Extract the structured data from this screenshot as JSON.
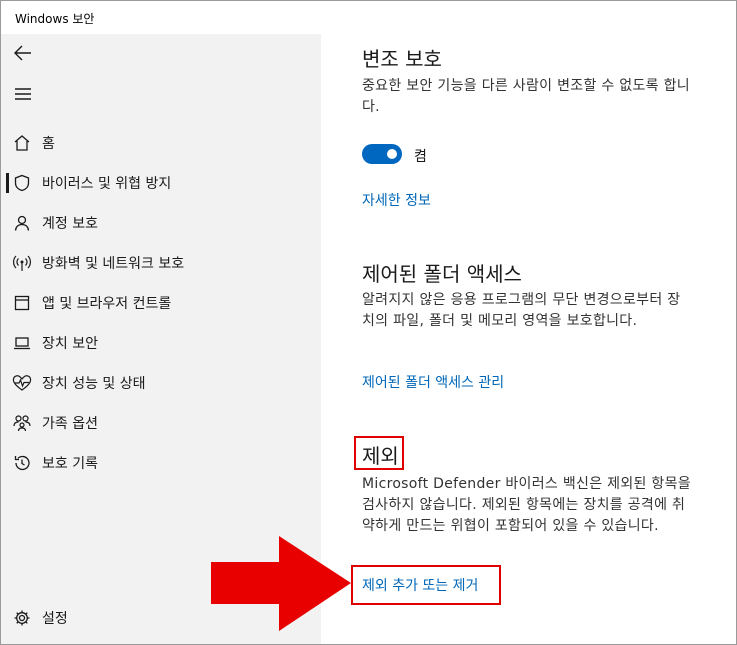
{
  "window": {
    "title": "Windows 보안"
  },
  "sidebar": {
    "back_icon": "back-arrow-icon",
    "menu_icon": "hamburger-menu-icon",
    "items": [
      {
        "label": "홈",
        "icon": "home-icon"
      },
      {
        "label": "바이러스 및 위협 방지",
        "icon": "shield-icon",
        "selected": true
      },
      {
        "label": "계정 보호",
        "icon": "person-icon"
      },
      {
        "label": "방화벽 및 네트워크 보호",
        "icon": "wifi-antenna-icon"
      },
      {
        "label": "앱 및 브라우저 컨트롤",
        "icon": "app-window-icon"
      },
      {
        "label": "장치 보안",
        "icon": "laptop-icon"
      },
      {
        "label": "장치 성능 및 상태",
        "icon": "heart-pulse-icon"
      },
      {
        "label": "가족 옵션",
        "icon": "family-icon"
      },
      {
        "label": "보호 기록",
        "icon": "history-icon"
      }
    ],
    "settings": {
      "label": "설정",
      "icon": "gear-icon"
    }
  },
  "tamper": {
    "title": "변조 보호",
    "desc": "중요한 보안 기능을 다른 사람이 변조할 수 없도록 합니다.",
    "toggle_state": "켬",
    "link": "자세한 정보"
  },
  "folder": {
    "title": "제어된 폴더 액세스",
    "desc": "알려지지 않은 응용 프로그램의 무단 변경으로부터 장치의 파일, 폴더 및 메모리 영역을 보호합니다.",
    "link": "제어된 폴더 액세스 관리"
  },
  "exclusions": {
    "title": "제외",
    "desc": "Microsoft Defender 바이러스 백신은 제외된 항목을 검사하지 않습니다. 제외된 항목에는 장치를 공격에 취약하게 만드는 위협이 포함되어 있을 수 있습니다.",
    "link": "제외 추가 또는 제거"
  },
  "colors": {
    "accent": "#0067c0",
    "link": "#0067b8",
    "highlight": "#e00000",
    "sidebar_bg": "#f2f2f2"
  }
}
